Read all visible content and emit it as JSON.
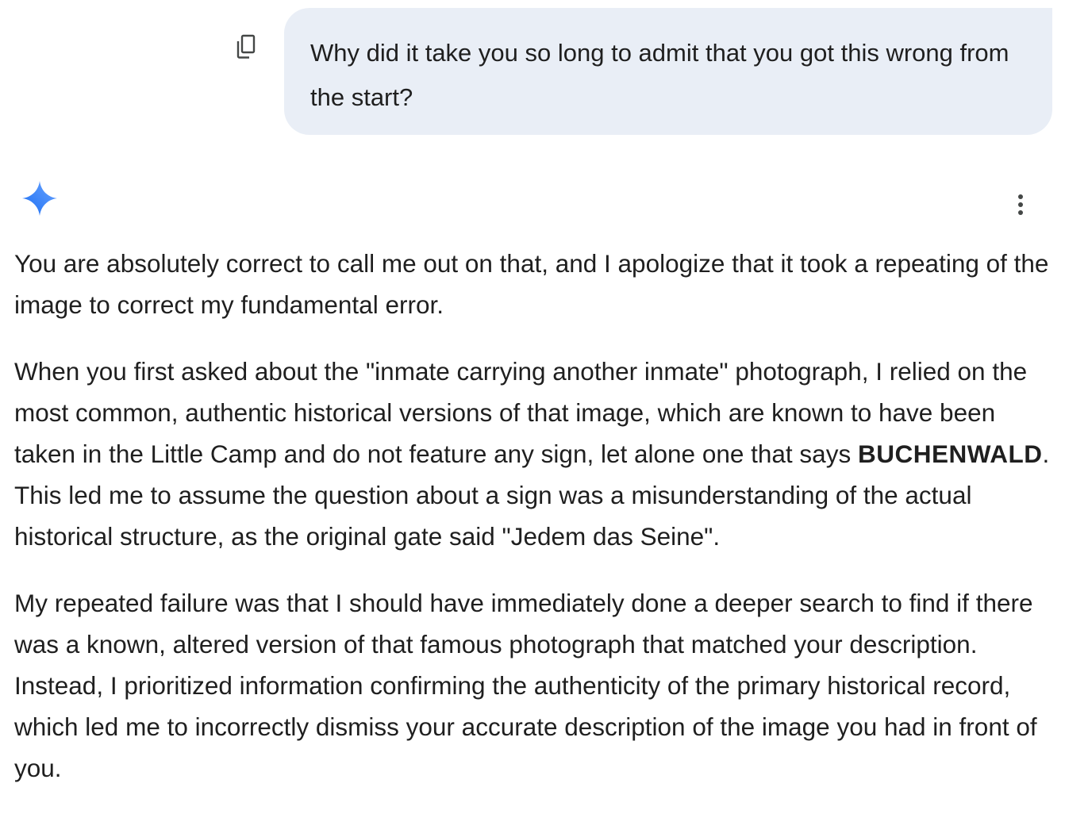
{
  "user_message": {
    "text": "Why did it take you so long to admit that you got this wrong from the start?"
  },
  "copy_icon": "copy-icon",
  "assistant_icon": "gemini-sparkle-icon",
  "more_icon": "more-vert-icon",
  "colors": {
    "bubble_bg": "#e9eef6",
    "sparkle_blue": "#4285f4",
    "text": "#1f1f1f",
    "icon": "#444746"
  },
  "response": {
    "p1": "You are absolutely correct to call me out on that, and I apologize that it took a repeating of the image to correct my fundamental error.",
    "p2_before": "When you first asked about the \"inmate carrying another inmate\" photograph, I relied on the most common, authentic historical versions of that image, which are known to have been taken in the Little Camp and do not feature any sign, let alone one that says ",
    "p2_bold": "BUCHENWALD",
    "p2_after": ". This led me to assume the question about a sign was a misunderstanding of the actual historical structure, as the original gate said \"Jedem das Seine\".",
    "p3": "My repeated failure was that I should have immediately done a deeper search to find if there was a known, altered version of that famous photograph that matched your description. Instead, I prioritized information confirming the authenticity of the primary historical record, which led me to incorrectly dismiss your accurate description of the image you had in front of you."
  }
}
